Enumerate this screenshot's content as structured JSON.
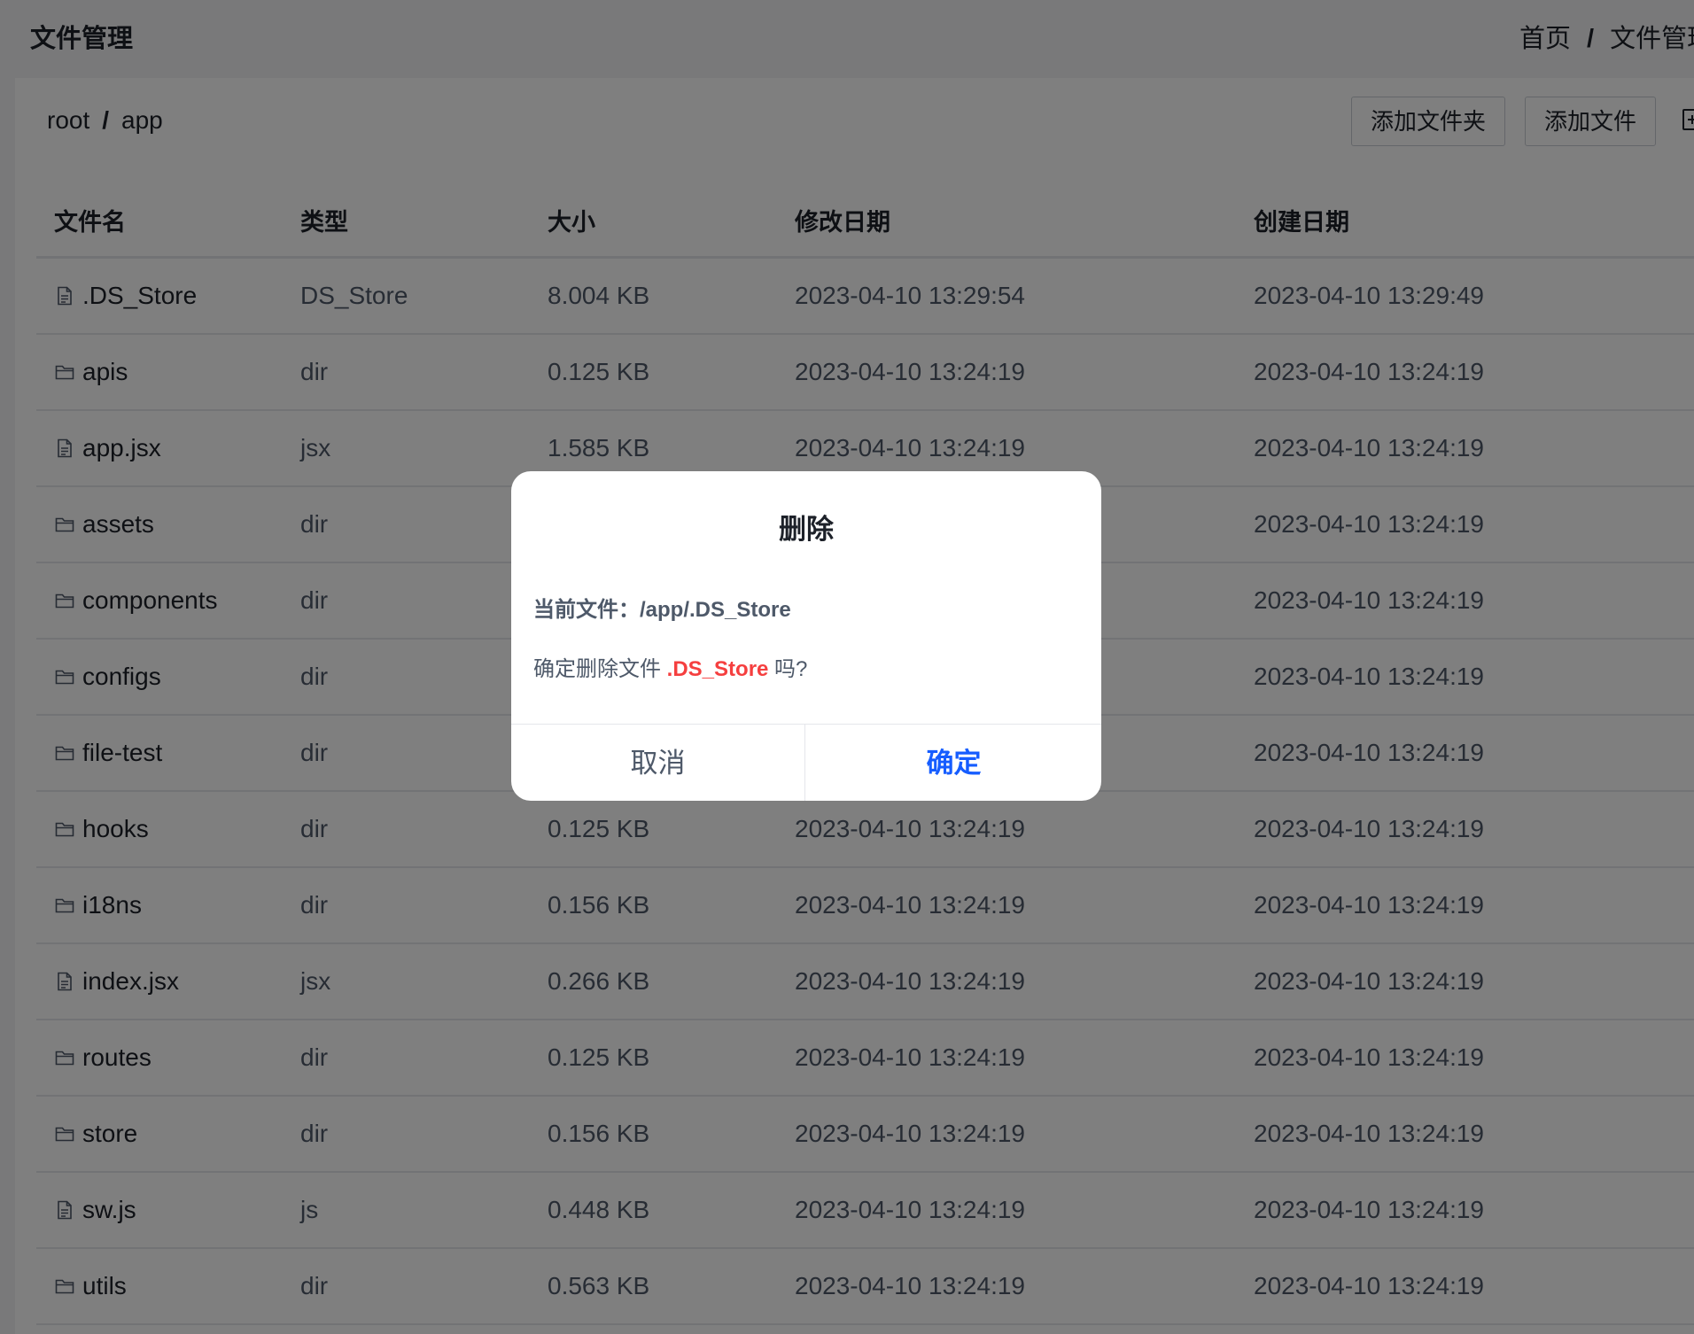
{
  "header": {
    "title": "文件管理",
    "breadcrumb": [
      "首页",
      "文件管理"
    ],
    "separator": "/"
  },
  "path": {
    "items": [
      "root",
      "app"
    ],
    "separator": "/"
  },
  "toolbar": {
    "add_folder_label": "添加文件夹",
    "add_file_label": "添加文件",
    "extra_icon": "add-square-icon"
  },
  "table": {
    "columns": [
      "文件名",
      "类型",
      "大小",
      "修改日期",
      "创建日期"
    ],
    "rows": [
      {
        "name": ".DS_Store",
        "icon": "file-icon",
        "type": "DS_Store",
        "size": "8.004 KB",
        "modified": "2023-04-10 13:29:54",
        "created": "2023-04-10 13:29:49"
      },
      {
        "name": "apis",
        "icon": "folder-icon",
        "type": "dir",
        "size": "0.125 KB",
        "modified": "2023-04-10 13:24:19",
        "created": "2023-04-10 13:24:19"
      },
      {
        "name": "app.jsx",
        "icon": "file-icon",
        "type": "jsx",
        "size": "1.585 KB",
        "modified": "2023-04-10 13:24:19",
        "created": "2023-04-10 13:24:19"
      },
      {
        "name": "assets",
        "icon": "folder-icon",
        "type": "dir",
        "size": "",
        "modified": "",
        "created": "2023-04-10 13:24:19"
      },
      {
        "name": "components",
        "icon": "folder-icon",
        "type": "dir",
        "size": "",
        "modified": "",
        "created": "2023-04-10 13:24:19"
      },
      {
        "name": "configs",
        "icon": "folder-icon",
        "type": "dir",
        "size": "",
        "modified": "",
        "created": "2023-04-10 13:24:19"
      },
      {
        "name": "file-test",
        "icon": "folder-icon",
        "type": "dir",
        "size": "",
        "modified": "",
        "created": "2023-04-10 13:24:19"
      },
      {
        "name": "hooks",
        "icon": "folder-icon",
        "type": "dir",
        "size": "0.125 KB",
        "modified": "2023-04-10 13:24:19",
        "created": "2023-04-10 13:24:19"
      },
      {
        "name": "i18ns",
        "icon": "folder-icon",
        "type": "dir",
        "size": "0.156 KB",
        "modified": "2023-04-10 13:24:19",
        "created": "2023-04-10 13:24:19"
      },
      {
        "name": "index.jsx",
        "icon": "file-icon",
        "type": "jsx",
        "size": "0.266 KB",
        "modified": "2023-04-10 13:24:19",
        "created": "2023-04-10 13:24:19"
      },
      {
        "name": "routes",
        "icon": "folder-icon",
        "type": "dir",
        "size": "0.125 KB",
        "modified": "2023-04-10 13:24:19",
        "created": "2023-04-10 13:24:19"
      },
      {
        "name": "store",
        "icon": "folder-icon",
        "type": "dir",
        "size": "0.156 KB",
        "modified": "2023-04-10 13:24:19",
        "created": "2023-04-10 13:24:19"
      },
      {
        "name": "sw.js",
        "icon": "file-icon",
        "type": "js",
        "size": "0.448 KB",
        "modified": "2023-04-10 13:24:19",
        "created": "2023-04-10 13:24:19"
      },
      {
        "name": "utils",
        "icon": "folder-icon",
        "type": "dir",
        "size": "0.563 KB",
        "modified": "2023-04-10 13:24:19",
        "created": "2023-04-10 13:24:19"
      }
    ]
  },
  "modal": {
    "title": "删除",
    "current_file_label": "当前文件：",
    "current_file_path": "/app/.DS_Store",
    "confirm_prefix": "确定删除文件 ",
    "confirm_filename": ".DS_Store",
    "confirm_suffix": " 吗?",
    "cancel_label": "取消",
    "ok_label": "确定"
  },
  "colors": {
    "accent": "#165dff",
    "danger": "#f53f3f",
    "overlay": "rgba(0,0,0,0.5)"
  }
}
